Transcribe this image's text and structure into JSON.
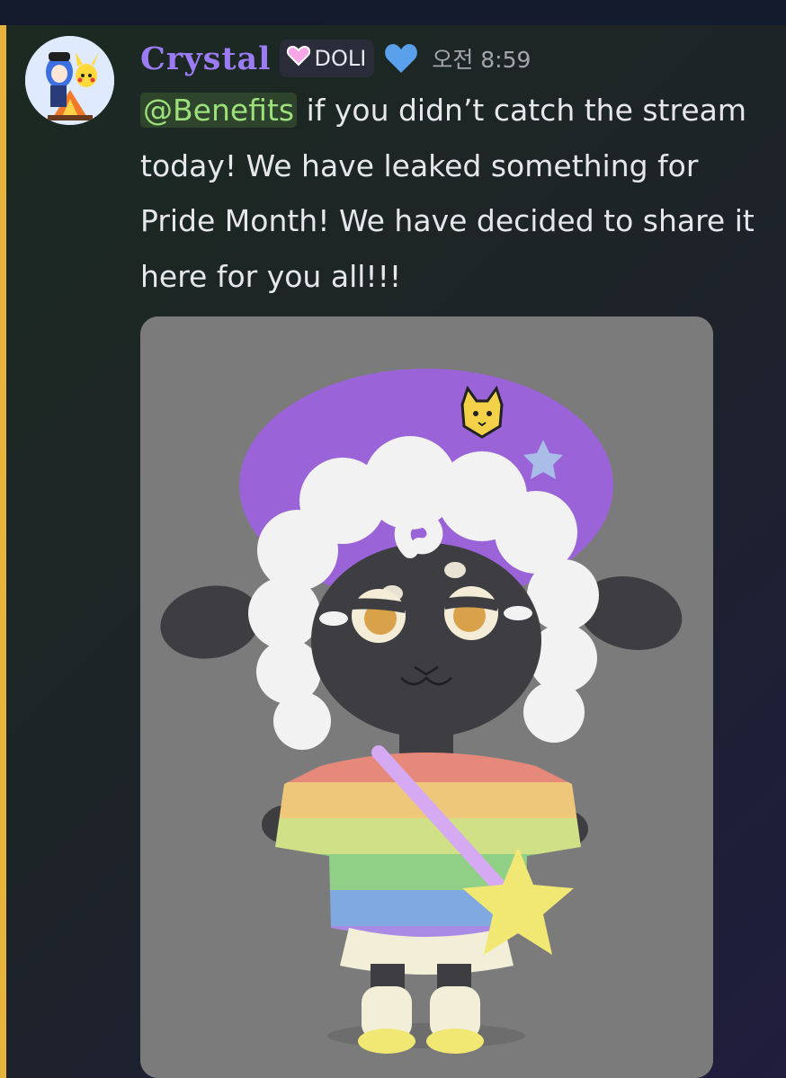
{
  "message": {
    "author": "Crystal",
    "role_badge": "DOLI",
    "timestamp": "오전 8:59",
    "mention": "@Benefits",
    "body": " if you didn’t catch the stream today! We have leaked something for Pride Month! We have decided to share it here for you all!!!"
  },
  "icons": {
    "role_badge_icon": "pink-heart-icon",
    "extra_badge": "blue-heart-icon"
  },
  "colors": {
    "username": "#9c7cf5",
    "mention_text": "#9ce07c",
    "side_accent": "#e8b33a",
    "attachment_bg": "#7b7b7c"
  }
}
